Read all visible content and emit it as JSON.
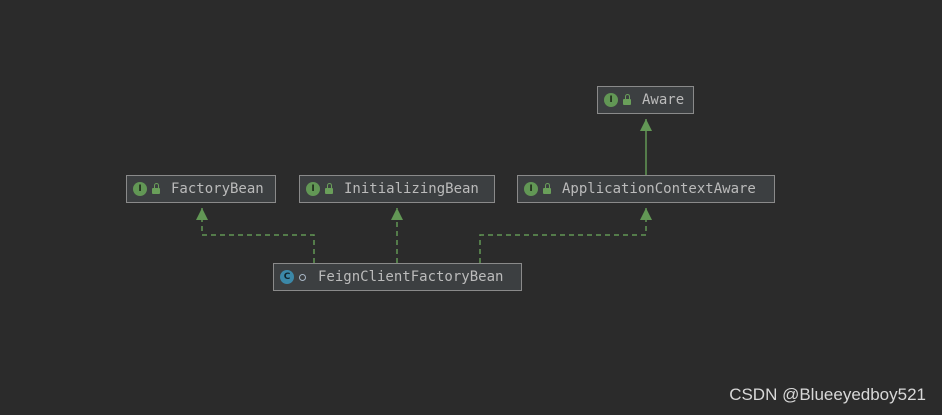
{
  "diagram": {
    "nodes": [
      {
        "id": "aware",
        "name": "Aware",
        "kind": "interface",
        "badge": "I"
      },
      {
        "id": "factorybean",
        "name": "FactoryBean",
        "kind": "interface",
        "badge": "I"
      },
      {
        "id": "initializingbean",
        "name": "InitializingBean",
        "kind": "interface",
        "badge": "I"
      },
      {
        "id": "applicationcontextaware",
        "name": "ApplicationContextAware",
        "kind": "interface",
        "badge": "I"
      },
      {
        "id": "feignclientfactorybean",
        "name": "FeignClientFactoryBean",
        "kind": "class",
        "badge": "C"
      }
    ],
    "edges": [
      {
        "from": "applicationcontextaware",
        "to": "aware",
        "type": "extends"
      },
      {
        "from": "feignclientfactorybean",
        "to": "factorybean",
        "type": "implements"
      },
      {
        "from": "feignclientfactorybean",
        "to": "initializingbean",
        "type": "implements"
      },
      {
        "from": "feignclientfactorybean",
        "to": "applicationcontextaware",
        "type": "implements"
      }
    ]
  },
  "colors": {
    "background": "#2b2b2b",
    "node_fill": "#3c3f41",
    "node_border": "#8a8a8a",
    "edge": "#629755",
    "interface_badge": "#629755",
    "class_badge": "#3b88a8",
    "text": "#bbbbbb"
  },
  "watermark": "CSDN @Blueeyedboy521"
}
